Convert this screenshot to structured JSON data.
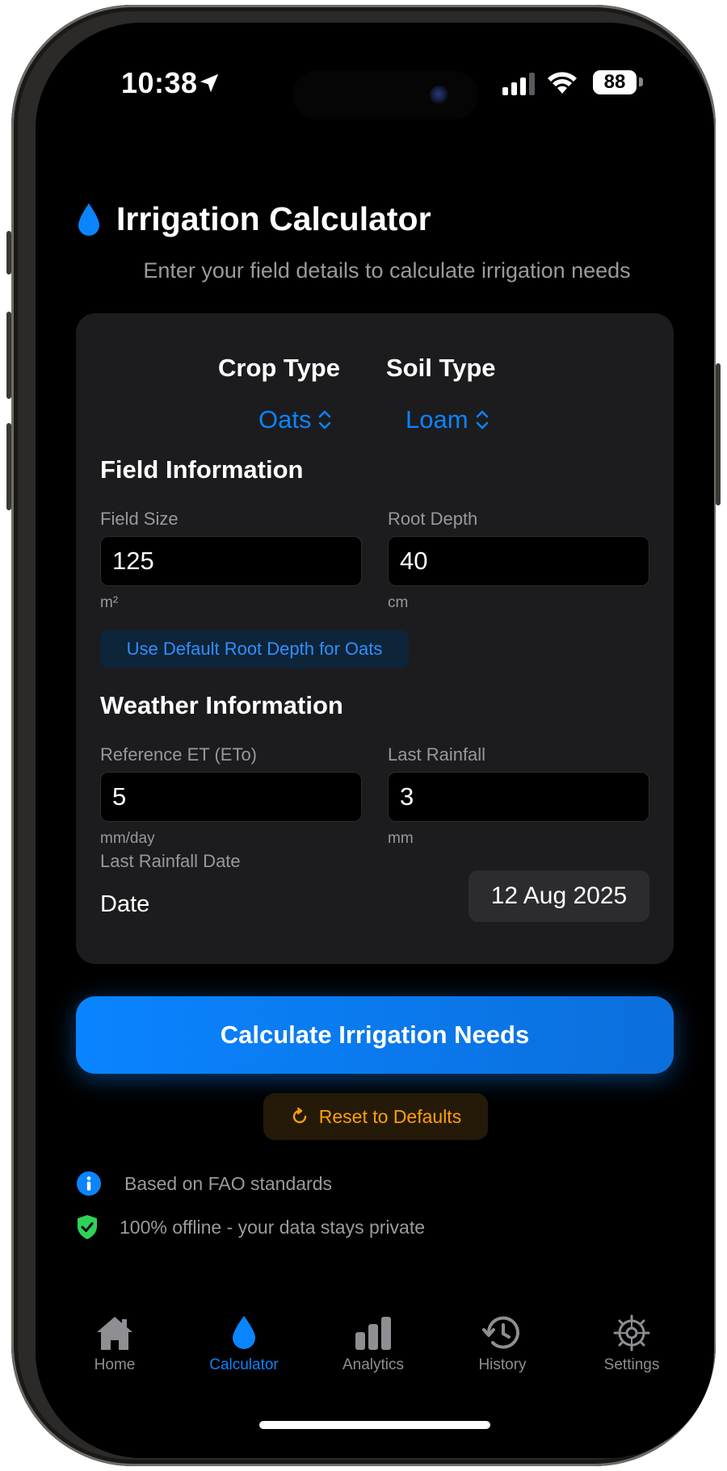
{
  "status_bar": {
    "time": "10:38",
    "battery": "88"
  },
  "header": {
    "title": "Irrigation Calculator",
    "subtitle": "Enter your field details to calculate irrigation needs"
  },
  "selectors": {
    "crop": {
      "label": "Crop Type",
      "value": "Oats"
    },
    "soil": {
      "label": "Soil Type",
      "value": "Loam"
    }
  },
  "field_info": {
    "title": "Field Information",
    "field_size": {
      "label": "Field Size",
      "value": "125",
      "unit": "m²"
    },
    "root_depth": {
      "label": "Root Depth",
      "value": "40",
      "unit": "cm"
    },
    "default_button": "Use Default Root Depth for Oats"
  },
  "weather_info": {
    "title": "Weather Information",
    "reference_et": {
      "label": "Reference ET (ETo)",
      "value": "5",
      "unit": "mm/day"
    },
    "last_rainfall": {
      "label": "Last Rainfall",
      "value": "3",
      "unit": "mm"
    },
    "rainfall_date_label": "Last Rainfall Date",
    "date_label": "Date",
    "date_value": "12 Aug 2025"
  },
  "actions": {
    "calculate": "Calculate Irrigation Needs",
    "reset": "Reset to Defaults"
  },
  "info": [
    {
      "text": "Based on FAO standards",
      "icon": "info-icon"
    },
    {
      "text": "100% offline - your data stays private",
      "icon": "shield-check-icon"
    }
  ],
  "tabs": [
    {
      "label": "Home",
      "icon": "house-icon"
    },
    {
      "label": "Calculator",
      "icon": "drop-icon",
      "active": true
    },
    {
      "label": "Analytics",
      "icon": "bar-chart-icon"
    },
    {
      "label": "History",
      "icon": "history-icon"
    },
    {
      "label": "Settings",
      "icon": "gear-icon"
    }
  ],
  "colors": {
    "accent": "#0a84ff",
    "warning": "#ff9f0a",
    "success": "#30d158",
    "card": "#1c1c1e"
  }
}
